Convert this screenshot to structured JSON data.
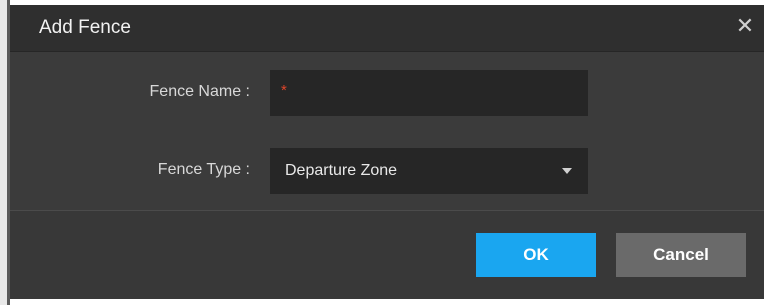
{
  "dialog": {
    "title": "Add Fence",
    "close_icon": "close-icon",
    "close_glyph": "✕"
  },
  "form": {
    "fence_name": {
      "label": "Fence Name :",
      "value": "",
      "required_mark": "*"
    },
    "fence_type": {
      "label": "Fence Type :",
      "selected": "Departure Zone",
      "chevron_icon": "chevron-down-icon"
    }
  },
  "buttons": {
    "ok_label": "OK",
    "cancel_label": "Cancel"
  },
  "colors": {
    "header_bg": "#2f2f2f",
    "body_bg": "#3b3b3b",
    "input_bg": "#262626",
    "primary_button": "#1aa6f0",
    "secondary_button": "#6a6a6a",
    "required_mark": "#e0452a"
  }
}
